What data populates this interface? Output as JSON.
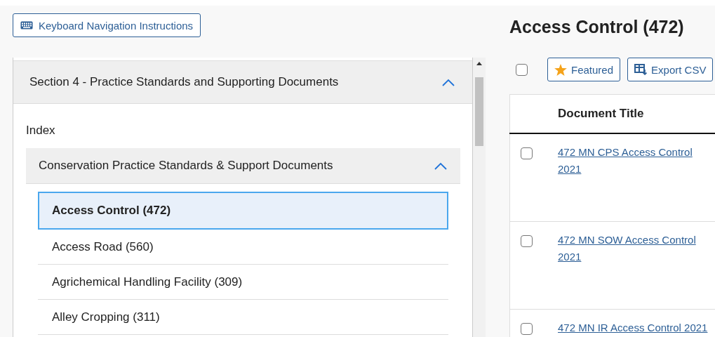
{
  "keyboard_button": {
    "label": "Keyboard Navigation Instructions"
  },
  "sidebar": {
    "section": {
      "title": "Section 4 - Practice Standards and Supporting Documents",
      "expanded": true
    },
    "items": [
      {
        "label": "Index",
        "kind": "link"
      },
      {
        "label": "Conservation Practice Standards & Support Documents",
        "kind": "group",
        "expanded": true,
        "children": [
          {
            "label": "Access Control (472)",
            "selected": true
          },
          {
            "label": "Access Road (560)",
            "selected": false
          },
          {
            "label": "Agrichemical Handling Facility (309)",
            "selected": false
          },
          {
            "label": "Alley Cropping (311)",
            "selected": false
          }
        ]
      }
    ]
  },
  "content": {
    "title": "Access Control (472)",
    "select_all": {
      "checked": false
    },
    "buttons": [
      {
        "label": "Featured",
        "kind": "star"
      },
      {
        "label": "Export CSV",
        "kind": "export"
      }
    ],
    "table": {
      "columns": [
        "Document Title"
      ],
      "rows": [
        {
          "title": "472 MN CPS Access Control 2021",
          "checked": false
        },
        {
          "title": "472 MN SOW Access Control 2021",
          "checked": false
        },
        {
          "title": "472 MN IR Access Control 2021",
          "checked": false
        }
      ]
    }
  }
}
